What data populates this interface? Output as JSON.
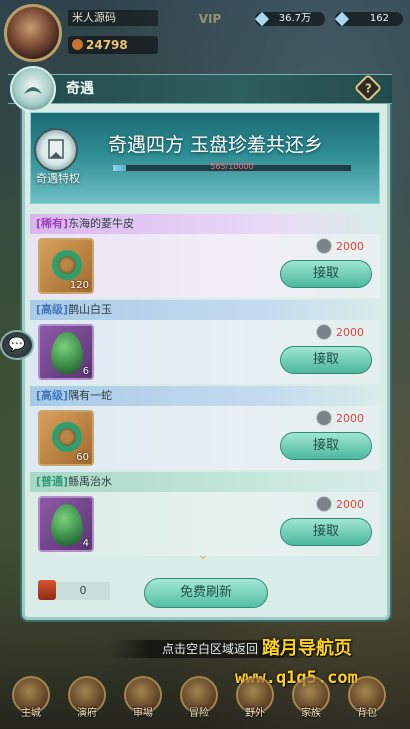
{
  "top_bar": {
    "player_name": "米人源码",
    "power": "24798",
    "vip_label": "VIP",
    "resource_1": "36.7万",
    "resource_2": "162"
  },
  "panel": {
    "title": "奇遇",
    "help_label": "?",
    "banner_title": "奇遇四方 玉盘珍羞共还乡",
    "privilege_label": "奇遇特权",
    "progress_text": "565/10000",
    "progress_fraction": 0.0565
  },
  "items": [
    {
      "tier": "[稀有]",
      "name": "东海的菱牛皮",
      "qty": "120",
      "cost": "2000",
      "claim_label": "接取",
      "icon": "jade-ring-icon"
    },
    {
      "tier": "[高级]",
      "name": "鹊山白玉",
      "qty": "6",
      "cost": "2000",
      "claim_label": "接取",
      "icon": "green-egg-icon"
    },
    {
      "tier": "[高级]",
      "name": "隅有一蛇",
      "qty": "60",
      "cost": "2000",
      "claim_label": "接取",
      "icon": "jade-ring-icon"
    },
    {
      "tier": "[普通]",
      "name": "鲧禹治水",
      "qty": "4",
      "cost": "2000",
      "claim_label": "接取",
      "icon": "green-egg-icon"
    }
  ],
  "footer": {
    "token_count": "0",
    "refresh_label": "免费刷新"
  },
  "tap_hint": "点击空白区域返回",
  "watermark": {
    "line1": "踏月导航页",
    "line2": "www.q1q5.com"
  },
  "bottom_nav": [
    "主城",
    "演府",
    "审場",
    "冒险",
    "野外",
    "家族",
    "背包"
  ],
  "colors": {
    "rare": "#9b44b8",
    "advanced": "#3f78c0",
    "common": "#2f9a74",
    "cost_red": "#e04343",
    "watermark_yellow": "#ffd21a"
  }
}
